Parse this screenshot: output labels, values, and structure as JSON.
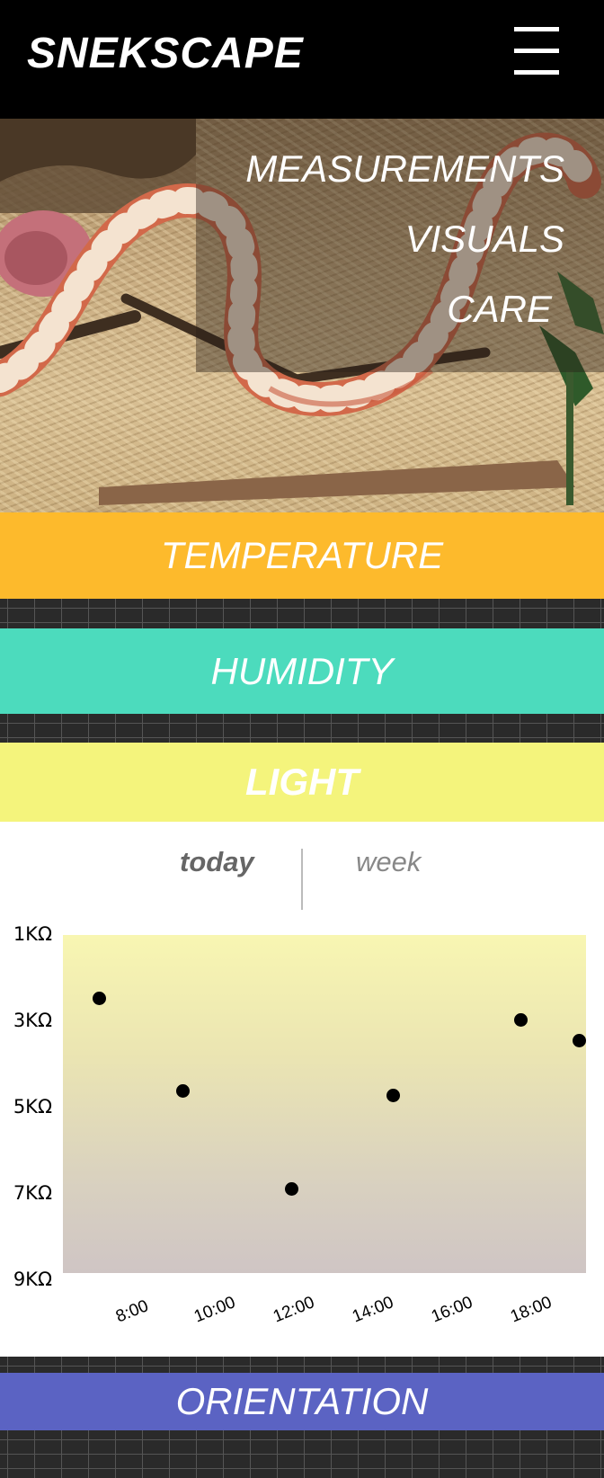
{
  "app": {
    "title": "SNEKSCAPE"
  },
  "icons": {
    "menu": "hamburger-menu-icon"
  },
  "nav": {
    "items": [
      "MEASUREMENTS",
      "VISUALS",
      "CARE"
    ]
  },
  "sections": {
    "temperature": {
      "label": "TEMPERATURE",
      "color": "#fdba2c"
    },
    "humidity": {
      "label": "HUMIDITY",
      "color": "#4cdbbd"
    },
    "light": {
      "label": "LIGHT",
      "color": "#f4f47c"
    },
    "orientation": {
      "label": "ORIENTATION",
      "color": "#5b63c3"
    }
  },
  "light": {
    "range_toggle": {
      "today": "today",
      "week": "week",
      "selected": "today"
    }
  },
  "chart_data": {
    "type": "scatter",
    "y_ticks": [
      "1KΩ",
      "3KΩ",
      "5KΩ",
      "7KΩ",
      "9KΩ"
    ],
    "ylim": [
      1,
      9
    ],
    "y_inverted": true,
    "x_ticks": [
      "8:00",
      "10:00",
      "12:00",
      "14:00",
      "16:00",
      "18:00"
    ],
    "xlim": [
      "7:00",
      "19:00"
    ],
    "points": [
      {
        "x": "7:50",
        "y": 2.5
      },
      {
        "x": "9:45",
        "y": 4.7
      },
      {
        "x": "12:15",
        "y": 7.0
      },
      {
        "x": "14:35",
        "y": 4.8
      },
      {
        "x": "17:30",
        "y": 3.0
      },
      {
        "x": "19:20",
        "y": 3.5
      }
    ],
    "grid": false
  }
}
